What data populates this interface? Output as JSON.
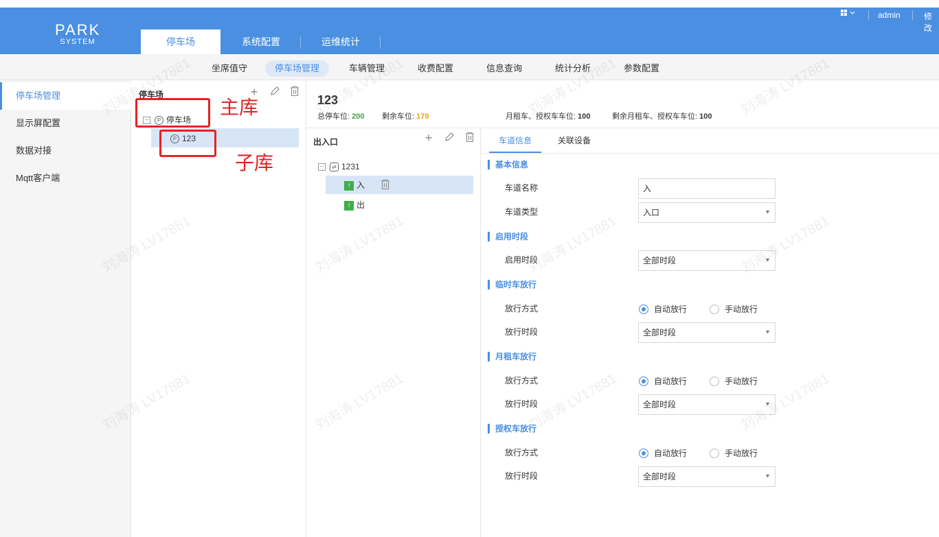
{
  "app": {
    "logo_line1": "PARK",
    "logo_line2": "SYSTEM",
    "user": "admin",
    "edit_label": "修改",
    "accent_color": "#4a8fe2",
    "grid_icon": "grid-icon"
  },
  "main_tabs": [
    "停车场",
    "系统配置",
    "运维统计"
  ],
  "subnav": [
    "坐席值守",
    "停车场管理",
    "车辆管理",
    "收费配置",
    "信息查询",
    "统计分析",
    "参数配置"
  ],
  "sidebar": [
    "停车场管理",
    "显示屏配置",
    "数据对接",
    "Mqtt客户端"
  ],
  "parking_panel": {
    "title": "停车场",
    "root_node": "停车场",
    "child_node": "123"
  },
  "annotations": {
    "main_label": "主库",
    "child_label": "子库"
  },
  "detail": {
    "title": "123",
    "total_label": "总停车位:",
    "total_value": "200",
    "remain_label": "剩余车位:",
    "remain_value": "179",
    "monthly_label": "月租车、授权车车位:",
    "monthly_value": "100",
    "monthly_remain_label": "剩余月租车、授权车车位:",
    "monthly_remain_value": "100"
  },
  "gate_panel": {
    "title": "出入口",
    "group_node": "1231",
    "entry": "入",
    "exit": "出"
  },
  "detail_tabs": [
    "车道信息",
    "关联设备"
  ],
  "sections": {
    "basic": "基本信息",
    "enable_period": "启用时段",
    "temp_car": "临时车放行",
    "monthly_car": "月租车放行",
    "auth_car": "授权车放行"
  },
  "form": {
    "lane_name_label": "车道名称",
    "lane_name_value": "入",
    "lane_type_label": "车道类型",
    "lane_type_value": "入口",
    "enable_period_label": "启用时段",
    "enable_period_value": "全部时段",
    "release_mode_label": "放行方式",
    "release_time_label": "放行时段",
    "auto_release": "自动放行",
    "manual_release": "手动放行",
    "all_periods": "全部时段"
  },
  "watermark": "刘海涛 LV17881"
}
